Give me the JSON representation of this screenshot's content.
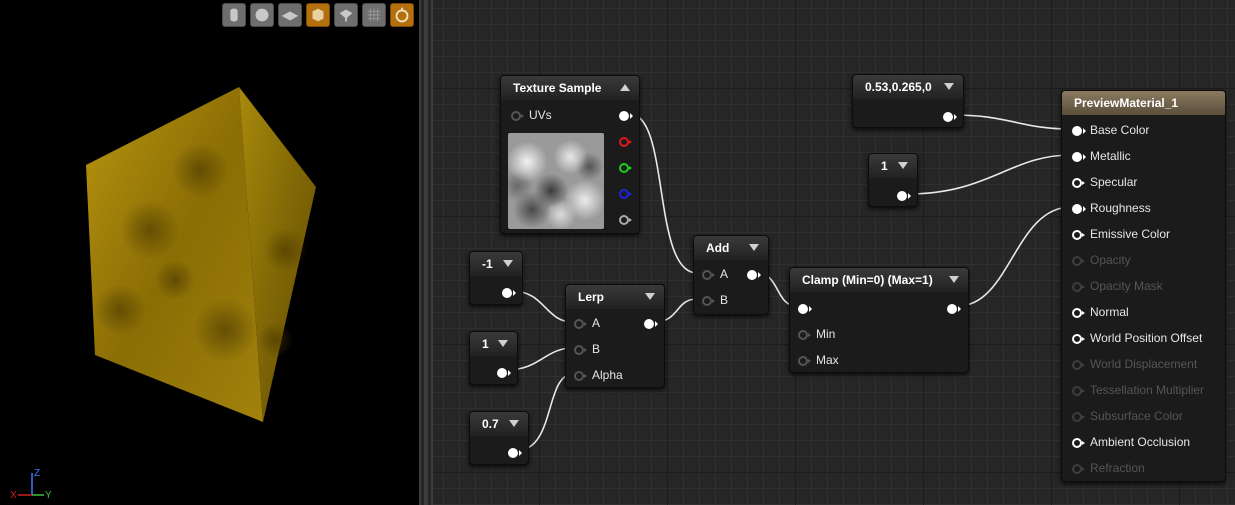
{
  "viewport": {
    "toolbar": [
      {
        "icon": "cylinder-icon",
        "active": false
      },
      {
        "icon": "sphere-icon",
        "active": false
      },
      {
        "icon": "plane-icon",
        "active": false
      },
      {
        "icon": "cube-icon",
        "active": true
      },
      {
        "icon": "custom-mesh-icon",
        "active": false
      },
      {
        "icon": "grid-icon",
        "active": false
      },
      {
        "icon": "realtime-icon",
        "active": true
      }
    ],
    "axis": {
      "z": "Z",
      "y": "Y",
      "x": "X"
    },
    "colors": {
      "cube_light": "#b8950f",
      "cube_dark": "#5c4700",
      "active_button": "#b5700e"
    }
  },
  "nodes": {
    "texture_sample": {
      "title": "Texture Sample",
      "uv_label": "UVs"
    },
    "const_neg1": {
      "value": "-1"
    },
    "const_1_lerp": {
      "value": "1"
    },
    "const_07": {
      "value": "0.7"
    },
    "lerp": {
      "title": "Lerp",
      "pins": [
        "A",
        "B",
        "Alpha"
      ]
    },
    "add": {
      "title": "Add",
      "pins": [
        "A",
        "B"
      ]
    },
    "clamp": {
      "title": "Clamp (Min=0) (Max=1)",
      "pins": [
        "Min",
        "Max"
      ]
    },
    "const_vec3": {
      "value": "0.53,0.265,0"
    },
    "const_1_metal": {
      "value": "1"
    },
    "result": {
      "title": "PreviewMaterial_1",
      "pins": [
        {
          "label": "Base Color",
          "state": "connected"
        },
        {
          "label": "Metallic",
          "state": "connected"
        },
        {
          "label": "Specular",
          "state": "open"
        },
        {
          "label": "Roughness",
          "state": "connected"
        },
        {
          "label": "Emissive Color",
          "state": "open"
        },
        {
          "label": "Opacity",
          "state": "disabled"
        },
        {
          "label": "Opacity Mask",
          "state": "disabled"
        },
        {
          "label": "Normal",
          "state": "open"
        },
        {
          "label": "World Position Offset",
          "state": "open"
        },
        {
          "label": "World Displacement",
          "state": "disabled"
        },
        {
          "label": "Tessellation Multiplier",
          "state": "disabled"
        },
        {
          "label": "Subsurface Color",
          "state": "disabled"
        },
        {
          "label": "Ambient Occlusion",
          "state": "open"
        },
        {
          "label": "Refraction",
          "state": "disabled"
        }
      ]
    }
  }
}
